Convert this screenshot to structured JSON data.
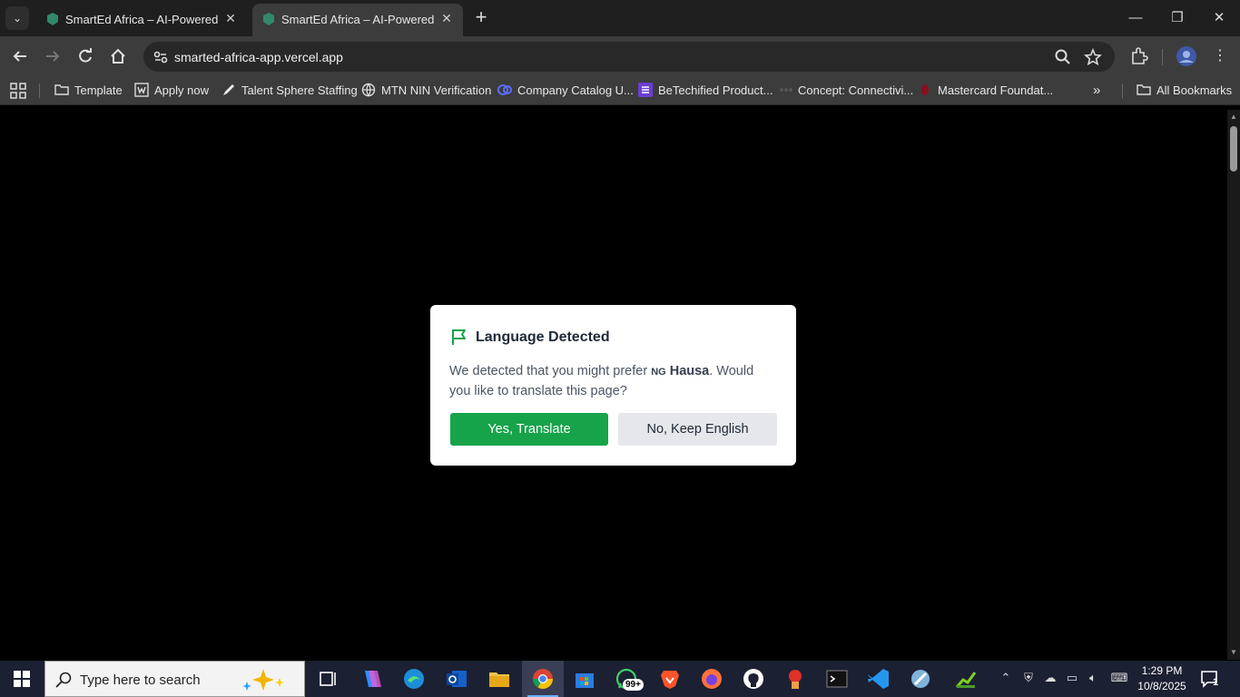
{
  "browser": {
    "tabs": [
      {
        "title": "SmartEd Africa – AI-Powered Of",
        "active": false
      },
      {
        "title": "SmartEd Africa – AI-Powered Of",
        "active": true
      }
    ],
    "url": "smarted-africa-app.vercel.app",
    "bookmarks": [
      {
        "label": "Template",
        "icon": "folder-icon"
      },
      {
        "label": "Apply now",
        "icon": "wellfound-icon"
      },
      {
        "label": "Talent Sphere Staffing",
        "icon": "pen-icon"
      },
      {
        "label": "MTN NIN Verification",
        "icon": "globe-icon"
      },
      {
        "label": "Company Catalog U...",
        "icon": "catalog-icon"
      },
      {
        "label": "BeTechified Product...",
        "icon": "list-icon"
      },
      {
        "label": "Concept: Connectivi...",
        "icon": "concept-icon"
      },
      {
        "label": "Mastercard Foundat...",
        "icon": "mastercard-icon"
      }
    ],
    "all_bookmarks_label": "All Bookmarks"
  },
  "dialog": {
    "title": "Language Detected",
    "body_prefix": "We detected that you might prefer ",
    "country_code": "NG",
    "language": "Hausa",
    "body_suffix": ". Would you like to translate this page?",
    "yes_label": "Yes, Translate",
    "no_label": "No, Keep English",
    "accent_color": "#16a34a"
  },
  "taskbar": {
    "search_placeholder": "Type here to search",
    "whatsapp_badge": "99+",
    "time": "1:29 PM",
    "date": "10/8/2025",
    "notification_count": "1"
  }
}
